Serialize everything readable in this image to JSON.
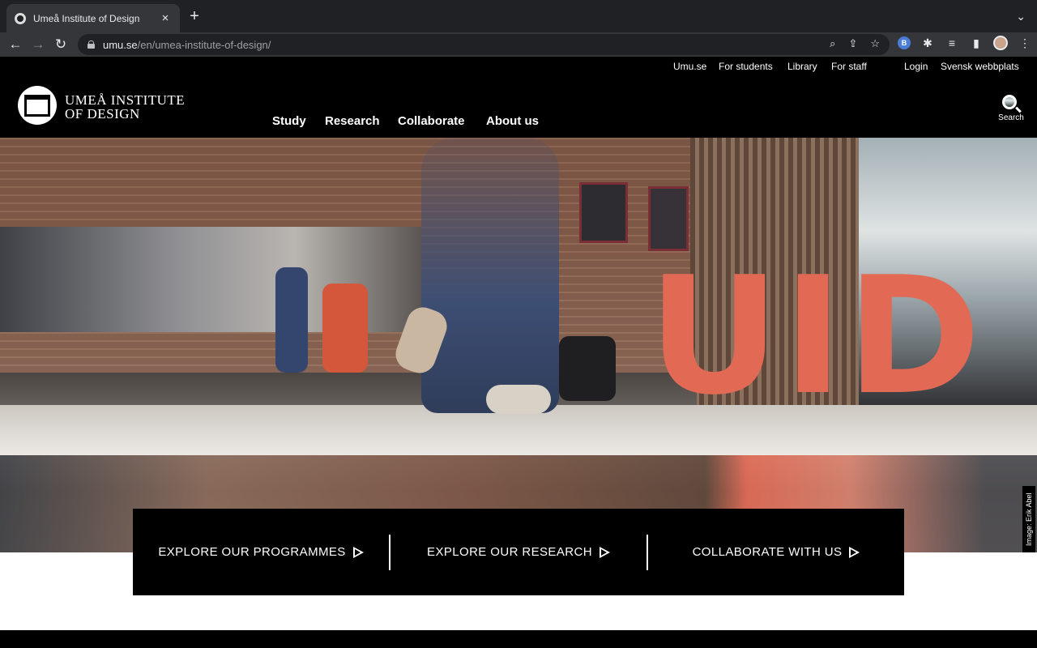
{
  "browser": {
    "tab_title": "Umeå Institute of Design",
    "tab_close": "×",
    "new_tab": "+",
    "url_host": "umu.se",
    "url_path": "/en/umea-institute-of-design/"
  },
  "utility_nav": [
    "Umu.se",
    "For students",
    "Library",
    "For staff",
    "Login",
    "Svensk webbplats"
  ],
  "logo": {
    "line1": "UMEÅ INSTITUTE",
    "line2": "OF DESIGN"
  },
  "main_nav": [
    "Study",
    "Research",
    "Collaborate",
    "About us"
  ],
  "search_label": "Search",
  "hero": {
    "sign_text": "UID",
    "image_credit": "Image: Erik Abel"
  },
  "cta": [
    "EXPLORE OUR PROGRAMMES",
    "EXPLORE OUR RESEARCH",
    "COLLABORATE WITH US"
  ],
  "colors": {
    "accent_sign": "#e26a55",
    "header_bg": "#000000",
    "browser_frame": "#202124"
  },
  "icons": [
    "back-icon",
    "forward-icon",
    "reload-icon",
    "lock-icon",
    "zoom-icon",
    "share-icon",
    "star-icon",
    "extensions-icon",
    "media-icon",
    "sidepanel-icon",
    "profile-avatar",
    "menu-icon",
    "search-icon",
    "arrow-right-icon"
  ]
}
